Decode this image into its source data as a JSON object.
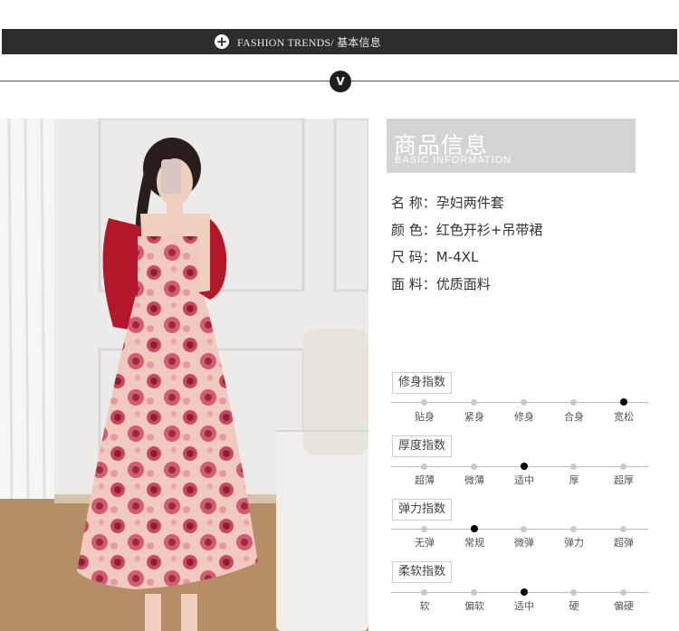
{
  "header": {
    "title": "FASHION TRENDS/  基本信息",
    "plus_icon": "plus-circle-icon",
    "v_icon": "chevron-down-icon"
  },
  "info": {
    "title_cn": "商品信息",
    "title_en": "BASIC  INFORMATION"
  },
  "specs": [
    {
      "label": "名  称：孕妇两件套"
    },
    {
      "label": "颜  色：红色开衫+吊带裙"
    },
    {
      "label": "尺  码：M-4XL"
    },
    {
      "label": "面  料：优质面料"
    }
  ],
  "meters": [
    {
      "name": "修身指数",
      "options": [
        "贴身",
        "紧身",
        "修身",
        "合身",
        "宽松"
      ],
      "selected": 4
    },
    {
      "name": "厚度指数",
      "options": [
        "超薄",
        "微薄",
        "适中",
        "厚",
        "超厚"
      ],
      "selected": 2
    },
    {
      "name": "弹力指数",
      "options": [
        "无弹",
        "常规",
        "微弹",
        "弹力",
        "超弹"
      ],
      "selected": 1
    },
    {
      "name": "柔软指数",
      "options": [
        "软",
        "偏软",
        "适中",
        "硬",
        "偏硬"
      ],
      "selected": 2
    }
  ],
  "colors": {
    "band": "#2e2c2d",
    "card": "#d6d4d2",
    "cardigan": "#b3182a",
    "dress_bg": "#f2c9bf",
    "rose": "#b2304a"
  }
}
